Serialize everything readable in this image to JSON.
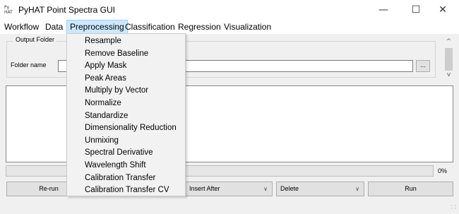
{
  "window": {
    "icon_text": "Py\nHAT",
    "title": "PyHAT Point Spectra GUI",
    "minimize_glyph": "—",
    "maximize_glyph": "☐",
    "close_glyph": "✕"
  },
  "menubar": {
    "items": [
      "Workflow",
      "Data",
      "Preprocessing",
      "Classification",
      "Regression",
      "Visualization"
    ],
    "active": "Preprocessing"
  },
  "preprocessing_menu": {
    "items": [
      "Resample",
      "Remove Baseline",
      "Apply Mask",
      "Peak Areas",
      "Multiply by Vector",
      "Normalize",
      "Standardize",
      "Dimensionality Reduction",
      "Unmixing",
      "Spectral Derivative",
      "Wavelength Shift",
      "Calibration Transfer",
      "Calibration Transfer CV"
    ]
  },
  "output_folder": {
    "group_title": "Output Folder",
    "label": "Folder name",
    "value": "",
    "browse_label": "..."
  },
  "scrollbar": {
    "up_icon": "chevron-up-icon",
    "down_icon": "chevron-down-icon",
    "up_glyph": "^",
    "down_glyph": "v"
  },
  "progress": {
    "value": 0,
    "text": "0%",
    "fill_color": "#06b025"
  },
  "bottom_bar": {
    "rerun_label": "Re-run",
    "insert_combo_value": "Insert After",
    "delete_combo_value": "Delete",
    "run_label": "Run",
    "combo_arrow": "∨"
  },
  "colors": {
    "menu_active_bg": "#cce8ff",
    "window_bg": "#f0f0f0"
  }
}
